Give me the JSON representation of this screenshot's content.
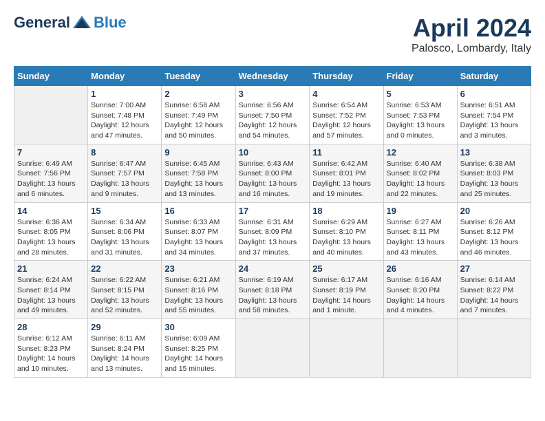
{
  "header": {
    "logo_general": "General",
    "logo_blue": "Blue",
    "month": "April 2024",
    "location": "Palosco, Lombardy, Italy"
  },
  "columns": [
    "Sunday",
    "Monday",
    "Tuesday",
    "Wednesday",
    "Thursday",
    "Friday",
    "Saturday"
  ],
  "weeks": [
    [
      {
        "day": "",
        "info": ""
      },
      {
        "day": "1",
        "info": "Sunrise: 7:00 AM\nSunset: 7:48 PM\nDaylight: 12 hours\nand 47 minutes."
      },
      {
        "day": "2",
        "info": "Sunrise: 6:58 AM\nSunset: 7:49 PM\nDaylight: 12 hours\nand 50 minutes."
      },
      {
        "day": "3",
        "info": "Sunrise: 6:56 AM\nSunset: 7:50 PM\nDaylight: 12 hours\nand 54 minutes."
      },
      {
        "day": "4",
        "info": "Sunrise: 6:54 AM\nSunset: 7:52 PM\nDaylight: 12 hours\nand 57 minutes."
      },
      {
        "day": "5",
        "info": "Sunrise: 6:53 AM\nSunset: 7:53 PM\nDaylight: 13 hours\nand 0 minutes."
      },
      {
        "day": "6",
        "info": "Sunrise: 6:51 AM\nSunset: 7:54 PM\nDaylight: 13 hours\nand 3 minutes."
      }
    ],
    [
      {
        "day": "7",
        "info": "Sunrise: 6:49 AM\nSunset: 7:56 PM\nDaylight: 13 hours\nand 6 minutes."
      },
      {
        "day": "8",
        "info": "Sunrise: 6:47 AM\nSunset: 7:57 PM\nDaylight: 13 hours\nand 9 minutes."
      },
      {
        "day": "9",
        "info": "Sunrise: 6:45 AM\nSunset: 7:58 PM\nDaylight: 13 hours\nand 13 minutes."
      },
      {
        "day": "10",
        "info": "Sunrise: 6:43 AM\nSunset: 8:00 PM\nDaylight: 13 hours\nand 16 minutes."
      },
      {
        "day": "11",
        "info": "Sunrise: 6:42 AM\nSunset: 8:01 PM\nDaylight: 13 hours\nand 19 minutes."
      },
      {
        "day": "12",
        "info": "Sunrise: 6:40 AM\nSunset: 8:02 PM\nDaylight: 13 hours\nand 22 minutes."
      },
      {
        "day": "13",
        "info": "Sunrise: 6:38 AM\nSunset: 8:03 PM\nDaylight: 13 hours\nand 25 minutes."
      }
    ],
    [
      {
        "day": "14",
        "info": "Sunrise: 6:36 AM\nSunset: 8:05 PM\nDaylight: 13 hours\nand 28 minutes."
      },
      {
        "day": "15",
        "info": "Sunrise: 6:34 AM\nSunset: 8:06 PM\nDaylight: 13 hours\nand 31 minutes."
      },
      {
        "day": "16",
        "info": "Sunrise: 6:33 AM\nSunset: 8:07 PM\nDaylight: 13 hours\nand 34 minutes."
      },
      {
        "day": "17",
        "info": "Sunrise: 6:31 AM\nSunset: 8:09 PM\nDaylight: 13 hours\nand 37 minutes."
      },
      {
        "day": "18",
        "info": "Sunrise: 6:29 AM\nSunset: 8:10 PM\nDaylight: 13 hours\nand 40 minutes."
      },
      {
        "day": "19",
        "info": "Sunrise: 6:27 AM\nSunset: 8:11 PM\nDaylight: 13 hours\nand 43 minutes."
      },
      {
        "day": "20",
        "info": "Sunrise: 6:26 AM\nSunset: 8:12 PM\nDaylight: 13 hours\nand 46 minutes."
      }
    ],
    [
      {
        "day": "21",
        "info": "Sunrise: 6:24 AM\nSunset: 8:14 PM\nDaylight: 13 hours\nand 49 minutes."
      },
      {
        "day": "22",
        "info": "Sunrise: 6:22 AM\nSunset: 8:15 PM\nDaylight: 13 hours\nand 52 minutes."
      },
      {
        "day": "23",
        "info": "Sunrise: 6:21 AM\nSunset: 8:16 PM\nDaylight: 13 hours\nand 55 minutes."
      },
      {
        "day": "24",
        "info": "Sunrise: 6:19 AM\nSunset: 8:18 PM\nDaylight: 13 hours\nand 58 minutes."
      },
      {
        "day": "25",
        "info": "Sunrise: 6:17 AM\nSunset: 8:19 PM\nDaylight: 14 hours\nand 1 minute."
      },
      {
        "day": "26",
        "info": "Sunrise: 6:16 AM\nSunset: 8:20 PM\nDaylight: 14 hours\nand 4 minutes."
      },
      {
        "day": "27",
        "info": "Sunrise: 6:14 AM\nSunset: 8:22 PM\nDaylight: 14 hours\nand 7 minutes."
      }
    ],
    [
      {
        "day": "28",
        "info": "Sunrise: 6:12 AM\nSunset: 8:23 PM\nDaylight: 14 hours\nand 10 minutes."
      },
      {
        "day": "29",
        "info": "Sunrise: 6:11 AM\nSunset: 8:24 PM\nDaylight: 14 hours\nand 13 minutes."
      },
      {
        "day": "30",
        "info": "Sunrise: 6:09 AM\nSunset: 8:25 PM\nDaylight: 14 hours\nand 15 minutes."
      },
      {
        "day": "",
        "info": ""
      },
      {
        "day": "",
        "info": ""
      },
      {
        "day": "",
        "info": ""
      },
      {
        "day": "",
        "info": ""
      }
    ]
  ]
}
